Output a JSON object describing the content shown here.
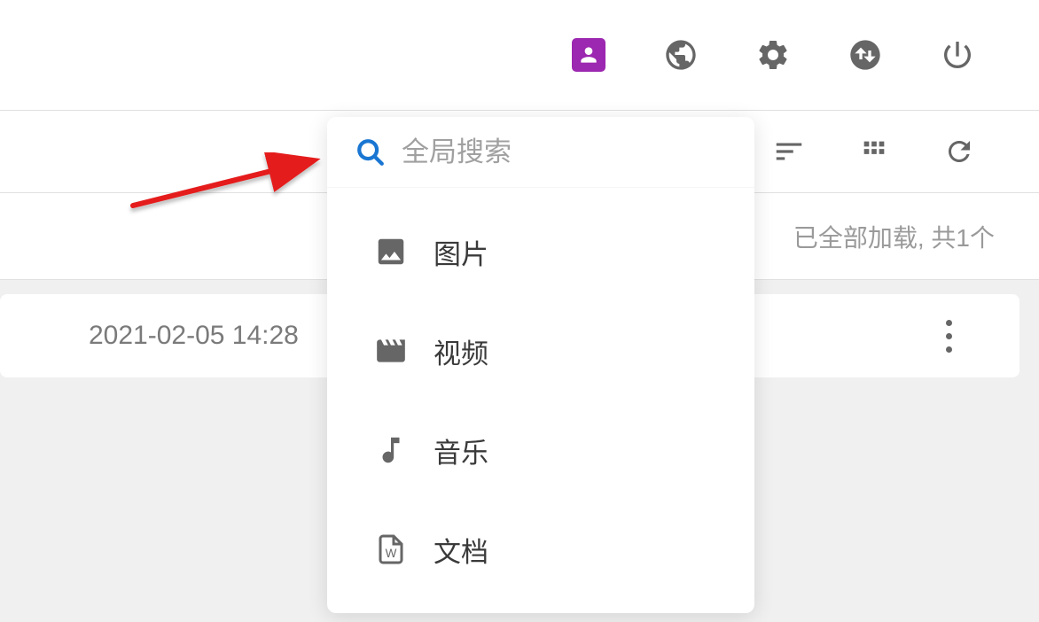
{
  "header": {
    "icons": {
      "account": "account-icon",
      "globe": "globe-icon",
      "settings": "gear-icon",
      "transfer": "swap-icon",
      "power": "power-icon"
    }
  },
  "toolbar": {
    "icons": {
      "sort": "sort-icon",
      "view": "grid-icon",
      "refresh": "refresh-icon"
    }
  },
  "status": {
    "loaded_text": "已全部加载, 共1个"
  },
  "item": {
    "date": "2021-02-05 14:28"
  },
  "search": {
    "placeholder": "全局搜索",
    "categories": [
      {
        "key": "image",
        "label": "图片"
      },
      {
        "key": "video",
        "label": "视频"
      },
      {
        "key": "music",
        "label": "音乐"
      },
      {
        "key": "document",
        "label": "文档"
      }
    ]
  }
}
